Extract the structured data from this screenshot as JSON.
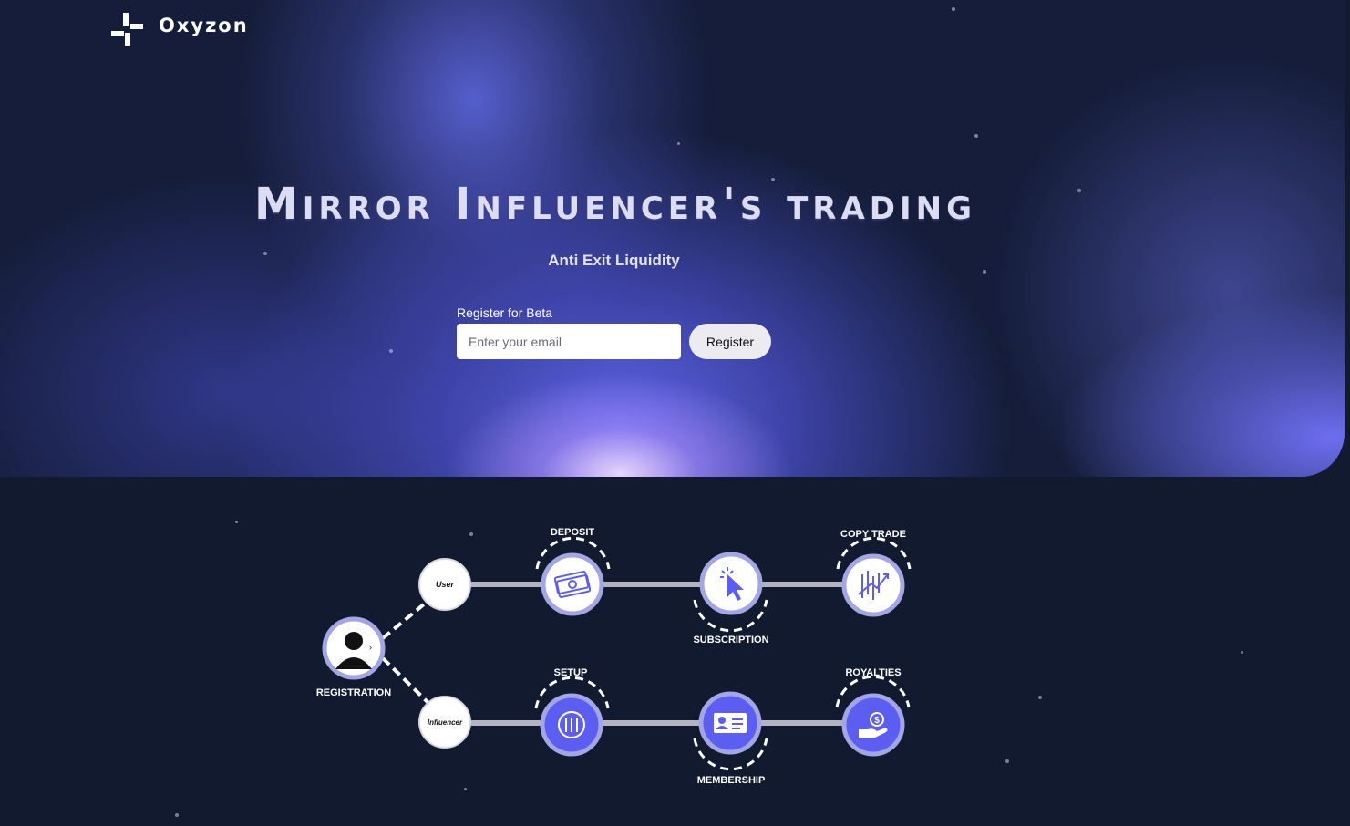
{
  "brand": {
    "name": "Oxyzon"
  },
  "hero": {
    "headline": "Mirror Influencer's trading",
    "subtitle": "Anti Exit Liquidity"
  },
  "signup": {
    "label": "Register for Beta",
    "email_placeholder": "Enter your email",
    "button_label": "Register"
  },
  "flow": {
    "registration": "REGISTRATION",
    "user": "User",
    "influencer": "Influencer",
    "deposit": "DEPOSIT",
    "subscription": "SUBSCRIPTION",
    "copy_trade": "COPY TRADE",
    "setup": "SETUP",
    "membership": "MEMBERSHIP",
    "royalties": "ROYALTIES"
  },
  "colors": {
    "accent": "#5b5ef0",
    "background": "#111a2e",
    "node_border": "#a3a6e4"
  }
}
